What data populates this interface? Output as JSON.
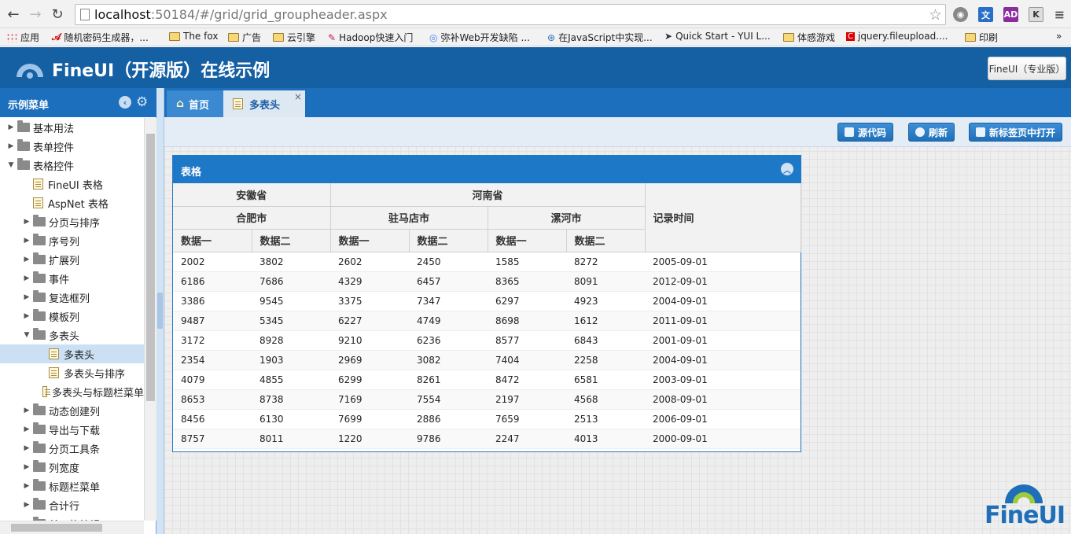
{
  "browser": {
    "url_host": "localhost",
    "url_rest": ":50184/#/grid/grid_groupheader.aspx",
    "bookmarks": [
      "应用",
      "随机密码生成器，...",
      "The fox",
      "广告",
      "云引擎",
      "Hadoop快速入门",
      "弥补Web开发缺陷 ...",
      "在JavaScript中实现...",
      "Quick Start - YUI L...",
      "体感游戏",
      "jquery.fileupload....",
      "印刷"
    ],
    "more": "»",
    "ext_ad": "AD",
    "ext_k": "K"
  },
  "app": {
    "title": "FineUI（开源版）在线示例",
    "pro_button": "FineUI（专业版）",
    "logo_text": "FineUI"
  },
  "sidebar": {
    "title": "示例菜单",
    "items": [
      {
        "label": "基本用法",
        "type": "folder",
        "level": 0,
        "expanded": false
      },
      {
        "label": "表单控件",
        "type": "folder",
        "level": 0,
        "expanded": false
      },
      {
        "label": "表格控件",
        "type": "folder",
        "level": 0,
        "expanded": true
      },
      {
        "label": "FineUI 表格",
        "type": "page",
        "level": 1
      },
      {
        "label": "AspNet 表格",
        "type": "page",
        "level": 1
      },
      {
        "label": "分页与排序",
        "type": "folder",
        "level": 1,
        "expanded": false
      },
      {
        "label": "序号列",
        "type": "folder",
        "level": 1,
        "expanded": false
      },
      {
        "label": "扩展列",
        "type": "folder",
        "level": 1,
        "expanded": false
      },
      {
        "label": "事件",
        "type": "folder",
        "level": 1,
        "expanded": false
      },
      {
        "label": "复选框列",
        "type": "folder",
        "level": 1,
        "expanded": false
      },
      {
        "label": "模板列",
        "type": "folder",
        "level": 1,
        "expanded": false
      },
      {
        "label": "多表头",
        "type": "folder",
        "level": 1,
        "expanded": true
      },
      {
        "label": "多表头",
        "type": "page",
        "level": 2,
        "selected": true
      },
      {
        "label": "多表头与排序",
        "type": "page",
        "level": 2
      },
      {
        "label": "多表头与标题栏菜单",
        "type": "page",
        "level": 2
      },
      {
        "label": "动态创建列",
        "type": "folder",
        "level": 1,
        "expanded": false
      },
      {
        "label": "导出与下载",
        "type": "folder",
        "level": 1,
        "expanded": false
      },
      {
        "label": "分页工具条",
        "type": "folder",
        "level": 1,
        "expanded": false
      },
      {
        "label": "列宽度",
        "type": "folder",
        "level": 1,
        "expanded": false
      },
      {
        "label": "标题栏菜单",
        "type": "folder",
        "level": 1,
        "expanded": false
      },
      {
        "label": "合计行",
        "type": "folder",
        "level": 1,
        "expanded": false
      },
      {
        "label": "单元格编辑",
        "type": "folder",
        "level": 1,
        "expanded": false
      }
    ]
  },
  "tabs": [
    {
      "label": "首页"
    },
    {
      "label": "多表头",
      "close": "×"
    }
  ],
  "toolbar": {
    "source_label": "源代码",
    "refresh_label": "刷新",
    "newtab_label": "新标签页中打开"
  },
  "grid": {
    "title": "表格",
    "province1": "安徽省",
    "province2": "河南省",
    "city1": "合肥市",
    "city2": "驻马店市",
    "city3": "漯河市",
    "col_a": "数据一",
    "col_b": "数据二",
    "col_time": "记录时间",
    "rows": [
      [
        "2002",
        "3802",
        "2602",
        "2450",
        "1585",
        "8272",
        "2005-09-01"
      ],
      [
        "6186",
        "7686",
        "4329",
        "6457",
        "8365",
        "8091",
        "2012-09-01"
      ],
      [
        "3386",
        "9545",
        "3375",
        "7347",
        "6297",
        "4923",
        "2004-09-01"
      ],
      [
        "9487",
        "5345",
        "6227",
        "4749",
        "8698",
        "1612",
        "2011-09-01"
      ],
      [
        "3172",
        "8928",
        "9210",
        "6236",
        "8577",
        "6843",
        "2001-09-01"
      ],
      [
        "2354",
        "1903",
        "2969",
        "3082",
        "7404",
        "2258",
        "2004-09-01"
      ],
      [
        "4079",
        "4855",
        "6299",
        "8261",
        "8472",
        "6581",
        "2003-09-01"
      ],
      [
        "8653",
        "8738",
        "7169",
        "7554",
        "2197",
        "4568",
        "2008-09-01"
      ],
      [
        "8456",
        "6130",
        "7699",
        "2886",
        "7659",
        "2513",
        "2006-09-01"
      ],
      [
        "8757",
        "8011",
        "1220",
        "9786",
        "2247",
        "4013",
        "2000-09-01"
      ]
    ]
  },
  "colors": {
    "header_bg": "#155fa3",
    "accent": "#1b6fbd"
  }
}
